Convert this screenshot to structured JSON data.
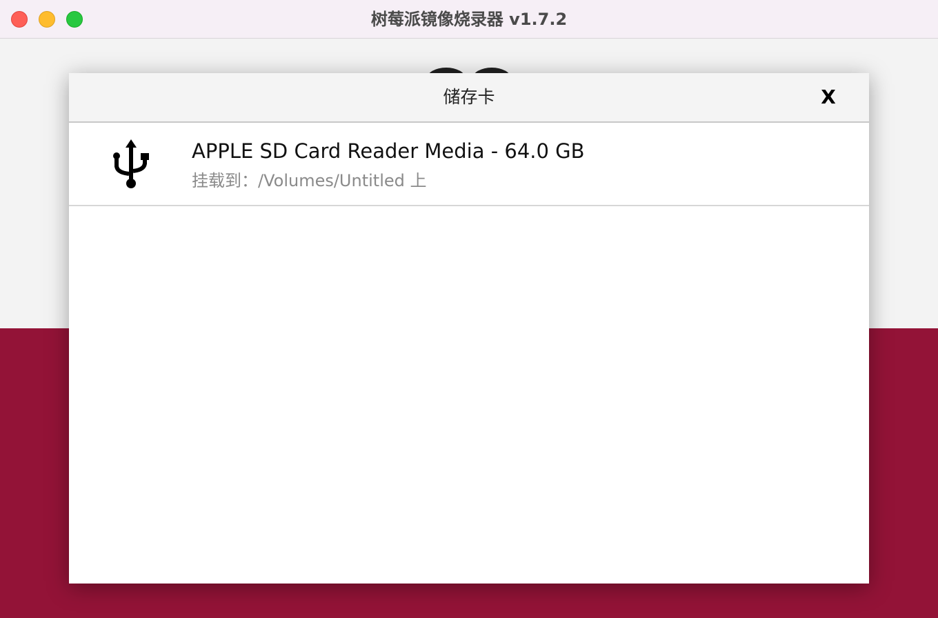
{
  "window": {
    "title": "树莓派镜像烧录器 v1.7.2"
  },
  "dialog": {
    "title": "储存卡",
    "close_label": "X"
  },
  "drives": [
    {
      "icon": "usb-icon",
      "name": "APPLE SD Card Reader Media - 64.0 GB",
      "mount": "挂载到：/Volumes/Untitled 上"
    }
  ],
  "colors": {
    "brand_red": "#c51a4a",
    "titlebar": "#f6eff6",
    "traffic_close": "#fe5f57",
    "traffic_minimize": "#febc2e",
    "traffic_zoom": "#28c840"
  }
}
